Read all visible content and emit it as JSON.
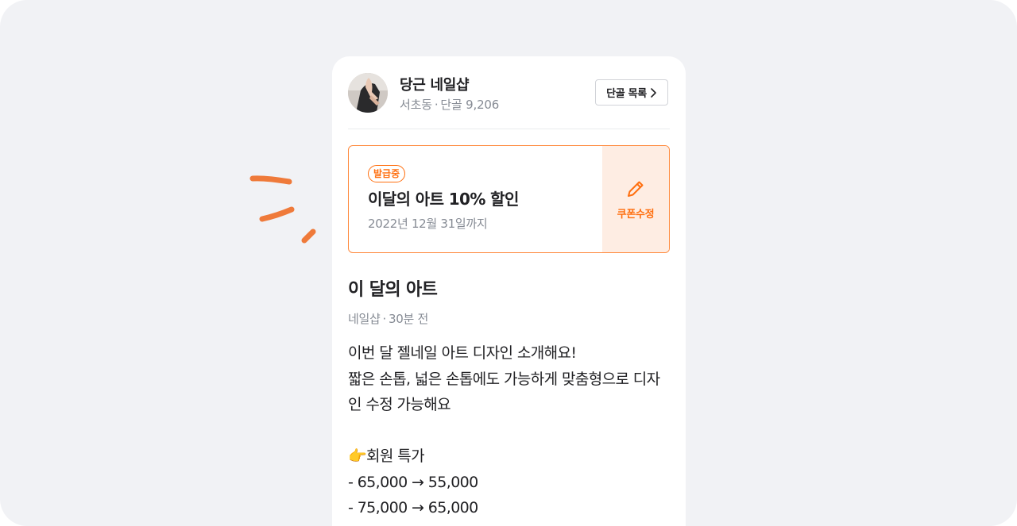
{
  "colors": {
    "background": "#f1f2f5",
    "accent": "#ff6f0f",
    "coupon_border": "#ff8a3d",
    "coupon_edit_bg": "#feede3",
    "text_primary": "#212124",
    "text_secondary": "#868b94"
  },
  "shop": {
    "name": "당근 네일샵",
    "location": "서초동",
    "regulars": "단골 9,206",
    "regulars_button": "단골 목록"
  },
  "coupon": {
    "badge": "발급중",
    "title": "이달의 아트 10% 할인",
    "expiry": "2022년 12월 31일까지",
    "edit_label": "쿠폰수정"
  },
  "post": {
    "title": "이 달의 아트",
    "author": "네일샵",
    "time": "30분 전",
    "body_lines": [
      "이번 달 젤네일 아트 디자인 소개해요!",
      "짧은 손톱, 넓은 손톱에도 가능하게 맞춤형으로 디자",
      "인 수정 가능해요",
      "",
      "👉회원 특가",
      " - 65,000 → 55,000",
      " - 75,000 → 65,000"
    ]
  },
  "icons": {
    "avatar": "hand-photo-avatar",
    "chevron": "chevron-right-icon",
    "edit": "pencil-icon",
    "decoration": "orange-brush-strokes"
  }
}
